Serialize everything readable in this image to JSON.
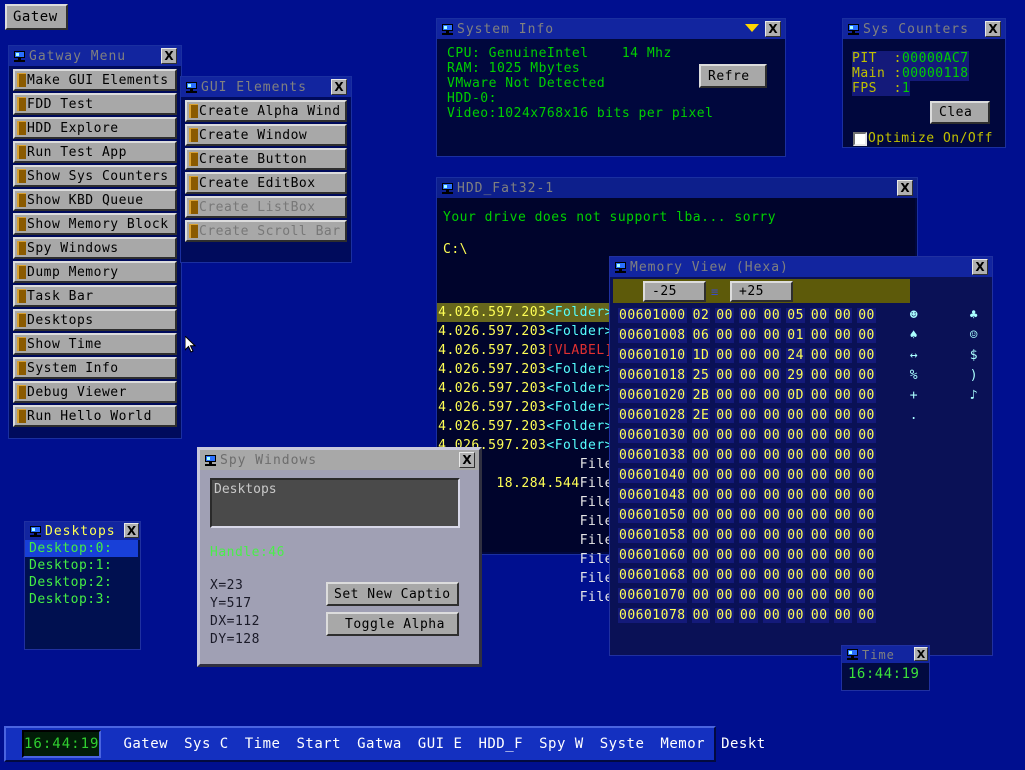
{
  "desktop": {
    "bg_color": "#000f8f"
  },
  "start_button": {
    "label": "Gatew",
    "icon": "app-icon"
  },
  "gatway_menu": {
    "title": "Gatway Menu",
    "close_label": "X",
    "items": [
      {
        "label": "Make GUI Elements"
      },
      {
        "label": "FDD Test"
      },
      {
        "label": "HDD Explore"
      },
      {
        "label": "Run Test App"
      },
      {
        "label": "Show Sys Counters"
      },
      {
        "label": "Show KBD Queue"
      },
      {
        "label": "Show Memory Block"
      },
      {
        "label": "Spy Windows"
      },
      {
        "label": "Dump Memory"
      },
      {
        "label": "Task Bar"
      },
      {
        "label": "Desktops"
      },
      {
        "label": "Show Time"
      },
      {
        "label": "System Info"
      },
      {
        "label": "Debug Viewer"
      },
      {
        "label": "Run Hello World"
      }
    ]
  },
  "gui_elements": {
    "title": "GUI Elements",
    "close_label": "X",
    "items": [
      {
        "label": "Create Alpha Wind",
        "disabled": false
      },
      {
        "label": "Create Window",
        "disabled": false
      },
      {
        "label": "Create Button",
        "disabled": false
      },
      {
        "label": "Create EditBox",
        "disabled": false
      },
      {
        "label": "Create ListBox",
        "disabled": true
      },
      {
        "label": "Create Scroll Bar",
        "disabled": true
      }
    ]
  },
  "system_info": {
    "title": "System Info",
    "close_label": "X",
    "refresh_label": "Refre",
    "lines": [
      "CPU: GenuineIntel    14 Mhz",
      "RAM: 1025 Mbytes",
      "VMware Not Detected",
      "HDD-0:",
      "Video:1024x768x16 bits per pixel"
    ]
  },
  "sys_counters": {
    "title": "Sys Counters",
    "close_label": "X",
    "clear_label": "Clea",
    "rows": [
      {
        "label": "PIT  :",
        "value": "00000AC7"
      },
      {
        "label": "Main :",
        "value": "00000118"
      },
      {
        "label": "FPS  :",
        "value": "1"
      }
    ],
    "checkbox_label": "Optimize On/Off",
    "checkbox_checked": false
  },
  "hdd_window": {
    "title": "HDD_Fat32-1",
    "close_label": "X",
    "message": "Your drive does not support lba... sorry",
    "path": "C:\\",
    "rows": [
      {
        "size": "4.026.597.203",
        "type": "<Folder>",
        "type_class": "cyan",
        "selected": true
      },
      {
        "size": "4.026.597.203",
        "type": "<Folder>",
        "type_class": "cyan",
        "selected": false
      },
      {
        "size": "4.026.597.203",
        "type": "[VLABEL]",
        "type_class": "red",
        "selected": false
      },
      {
        "size": "4.026.597.203",
        "type": "<Folder>",
        "type_class": "cyan",
        "selected": false
      },
      {
        "size": "4.026.597.203",
        "type": "<Folder>",
        "type_class": "cyan",
        "selected": false
      },
      {
        "size": "4.026.597.203",
        "type": "<Folder>",
        "type_class": "cyan",
        "selected": false
      },
      {
        "size": "4.026.597.203",
        "type": "<Folder>",
        "type_class": "cyan",
        "selected": false
      },
      {
        "size": "4.026.597.203",
        "type": "<Folder>",
        "type_class": "cyan",
        "selected": false
      },
      {
        "size": "",
        "type": "File",
        "type_class": "white",
        "selected": false
      },
      {
        "size": "18.284.544",
        "type": "File",
        "type_class": "white",
        "selected": false
      },
      {
        "size": "",
        "type": "File",
        "type_class": "white",
        "selected": false
      },
      {
        "size": "",
        "type": "File",
        "type_class": "white",
        "selected": false
      },
      {
        "size": "",
        "type": "File",
        "type_class": "white",
        "selected": false
      },
      {
        "size": "",
        "type": "File",
        "type_class": "white",
        "selected": false
      },
      {
        "size": "",
        "type": "File",
        "type_class": "white",
        "selected": false
      },
      {
        "size": "",
        "type": "File",
        "type_class": "white",
        "selected": false
      }
    ]
  },
  "memory_view": {
    "title": "Memory View (Hexa)",
    "close_label": "X",
    "minus_label": "-25",
    "plus_label": "+25",
    "rows": [
      {
        "addr": "00601000",
        "bytes": [
          "02",
          "00",
          "00",
          "00",
          "05",
          "00",
          "00",
          "00"
        ],
        "glyph1": "☻",
        "glyph2": "♣"
      },
      {
        "addr": "00601008",
        "bytes": [
          "06",
          "00",
          "00",
          "00",
          "01",
          "00",
          "00",
          "00"
        ],
        "glyph1": "♠",
        "glyph2": "☺"
      },
      {
        "addr": "00601010",
        "bytes": [
          "1D",
          "00",
          "00",
          "00",
          "24",
          "00",
          "00",
          "00"
        ],
        "glyph1": "↔",
        "glyph2": "$"
      },
      {
        "addr": "00601018",
        "bytes": [
          "25",
          "00",
          "00",
          "00",
          "29",
          "00",
          "00",
          "00"
        ],
        "glyph1": "%",
        "glyph2": ")"
      },
      {
        "addr": "00601020",
        "bytes": [
          "2B",
          "00",
          "00",
          "00",
          "0D",
          "00",
          "00",
          "00"
        ],
        "glyph1": "+",
        "glyph2": "♪"
      },
      {
        "addr": "00601028",
        "bytes": [
          "2E",
          "00",
          "00",
          "00",
          "00",
          "00",
          "00",
          "00"
        ],
        "glyph1": ".",
        "glyph2": ""
      },
      {
        "addr": "00601030",
        "bytes": [
          "00",
          "00",
          "00",
          "00",
          "00",
          "00",
          "00",
          "00"
        ],
        "glyph1": "",
        "glyph2": ""
      },
      {
        "addr": "00601038",
        "bytes": [
          "00",
          "00",
          "00",
          "00",
          "00",
          "00",
          "00",
          "00"
        ],
        "glyph1": "",
        "glyph2": ""
      },
      {
        "addr": "00601040",
        "bytes": [
          "00",
          "00",
          "00",
          "00",
          "00",
          "00",
          "00",
          "00"
        ],
        "glyph1": "",
        "glyph2": ""
      },
      {
        "addr": "00601048",
        "bytes": [
          "00",
          "00",
          "00",
          "00",
          "00",
          "00",
          "00",
          "00"
        ],
        "glyph1": "",
        "glyph2": ""
      },
      {
        "addr": "00601050",
        "bytes": [
          "00",
          "00",
          "00",
          "00",
          "00",
          "00",
          "00",
          "00"
        ],
        "glyph1": "",
        "glyph2": ""
      },
      {
        "addr": "00601058",
        "bytes": [
          "00",
          "00",
          "00",
          "00",
          "00",
          "00",
          "00",
          "00"
        ],
        "glyph1": "",
        "glyph2": ""
      },
      {
        "addr": "00601060",
        "bytes": [
          "00",
          "00",
          "00",
          "00",
          "00",
          "00",
          "00",
          "00"
        ],
        "glyph1": "",
        "glyph2": ""
      },
      {
        "addr": "00601068",
        "bytes": [
          "00",
          "00",
          "00",
          "00",
          "00",
          "00",
          "00",
          "00"
        ],
        "glyph1": "",
        "glyph2": ""
      },
      {
        "addr": "00601070",
        "bytes": [
          "00",
          "00",
          "00",
          "00",
          "00",
          "00",
          "00",
          "00"
        ],
        "glyph1": "",
        "glyph2": ""
      },
      {
        "addr": "00601078",
        "bytes": [
          "00",
          "00",
          "00",
          "00",
          "00",
          "00",
          "00",
          "00"
        ],
        "glyph1": "",
        "glyph2": ""
      }
    ]
  },
  "spy_windows": {
    "title": "Spy Windows",
    "close_label": "X",
    "list_value": "Desktops",
    "handle": "Handle:46",
    "x": "X=23",
    "y": "Y=517",
    "dx": "DX=112",
    "dy": "DY=128",
    "set_caption_label": "Set New Captio",
    "toggle_alpha_label": "Toggle Alpha"
  },
  "desktops": {
    "title": "Desktops",
    "close_label": "X",
    "items": [
      {
        "label": "Desktop:0:",
        "selected": true
      },
      {
        "label": "Desktop:1:",
        "selected": false
      },
      {
        "label": "Desktop:2:",
        "selected": false
      },
      {
        "label": "Desktop:3:",
        "selected": false
      }
    ]
  },
  "time_window": {
    "title": "Time",
    "close_label": "X",
    "value": "16:44:19"
  },
  "taskbar": {
    "clock": "16:44:19",
    "tasks": [
      "Gatew",
      "Sys C",
      "Time",
      "Start",
      "Gatwa",
      "GUI E",
      "HDD_F",
      "Spy W",
      "Syste",
      "Memor",
      "Deskt"
    ]
  }
}
